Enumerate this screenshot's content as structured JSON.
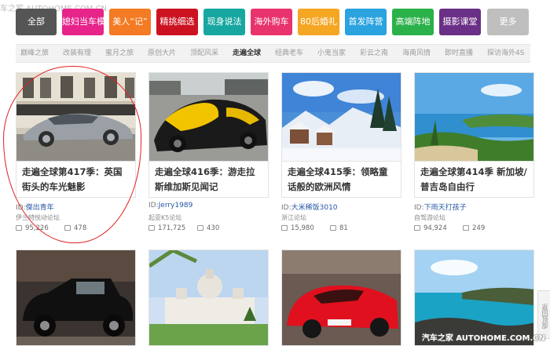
{
  "watermark": {
    "top": "车之家 AUTOHOME.COM.CN",
    "bottom": "汽车之家 AUTOHOME.COM.CN"
  },
  "categories": [
    {
      "label": "全部",
      "color": "#555555"
    },
    {
      "label": "媳妇当车模",
      "color": "#e6248a"
    },
    {
      "label": "美人“记”",
      "color": "#f47a23"
    },
    {
      "label": "精挑细选",
      "color": "#cc1221"
    },
    {
      "label": "现身说法",
      "color": "#17a7a0"
    },
    {
      "label": "海外购车",
      "color": "#e8336d"
    },
    {
      "label": "80后婚礼",
      "color": "#f5a623"
    },
    {
      "label": "首发阵营",
      "color": "#2aa3df"
    },
    {
      "label": "高端阵地",
      "color": "#2bb14a"
    },
    {
      "label": "摄影课堂",
      "color": "#6a2f86"
    },
    {
      "label": "更多",
      "color": "#bfbfbf"
    }
  ],
  "subnav": [
    "巅峰之旅",
    "改装有理",
    "蜜月之旅",
    "原创大片",
    "顶配风采",
    "走遍全球",
    "经典老车",
    "小鬼当家",
    "彩云之南",
    "海南风情",
    "即时直播",
    "探访海外4S"
  ],
  "subnav_active": "走遍全球",
  "cards": [
    {
      "title": "走遍全球第417季：英国街头的车光魅影",
      "id_prefix": "ID:",
      "author": "傑出青年",
      "forum": "伊兰特悦动论坛",
      "views": "95,226",
      "replies": "478"
    },
    {
      "title": "走遍全球416季：游走拉斯维加斯见闻记",
      "id_prefix": "ID:",
      "author": "Jerry1989",
      "forum": "起亚K5论坛",
      "views": "171,725",
      "replies": "430"
    },
    {
      "title": "走遍全球415季：领略童话般的欧洲风情",
      "id_prefix": "ID:",
      "author": "大米稀饭3010",
      "forum": "浙江论坛",
      "views": "15,980",
      "replies": "81"
    },
    {
      "title": "走遍全球第414季 新加坡/普吉岛自由行",
      "id_prefix": "ID:",
      "author": "下雨天打孩子",
      "forum": "自驾游论坛",
      "views": "94,924",
      "replies": "249"
    }
  ],
  "back_to_top": "返回顶部"
}
